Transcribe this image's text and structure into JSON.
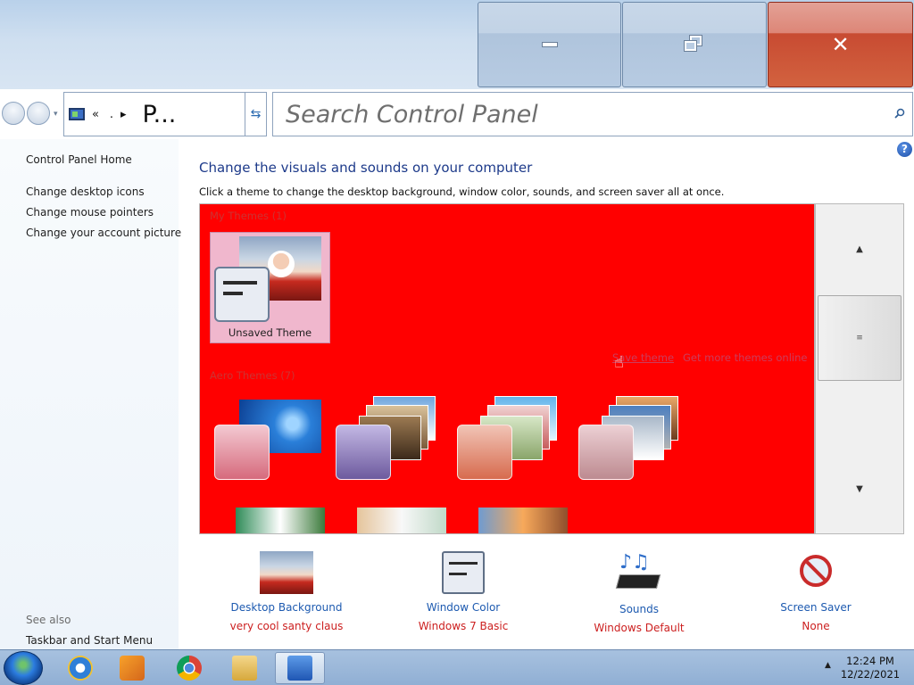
{
  "window": {
    "caption_buttons": {
      "minimize_icon": "minimize-icon",
      "maximize_icon": "restore-icon",
      "close_icon": "close-icon",
      "close_glyph": "✕"
    }
  },
  "address_bar": {
    "crumb_prefix": "«",
    "crumb_middle": "  .",
    "crumb_arrow": "▸",
    "crumb_current": "P...",
    "dropdown_glyph": "▾",
    "refresh_glyph": "⇆"
  },
  "search": {
    "placeholder": "Search Control Panel"
  },
  "sidebar": {
    "home": "Control Panel Home",
    "links": [
      "Change desktop icons",
      "Change mouse pointers",
      "Change your account picture"
    ],
    "see_also_label": "See also",
    "see_also_links": [
      "Taskbar and Start Menu"
    ]
  },
  "main": {
    "help_glyph": "?",
    "heading": "Change the visuals and sounds on your computer",
    "subtext": "Click a theme to change the desktop background, window color, sounds, and screen saver all at once.",
    "panel_color": "#ff0000",
    "my_themes_label": "My Themes (1)",
    "unsaved_theme": "Unsaved Theme",
    "save_theme": "Save theme",
    "get_more_themes": "Get more themes online",
    "aero_themes_label": "Aero Themes (7)",
    "scroll_up": "▲",
    "scroll_thumb": "≡",
    "scroll_down": "▼"
  },
  "settings": [
    {
      "title": "Desktop Background",
      "value": "very cool santy claus",
      "icon": "desktop-background-icon"
    },
    {
      "title": "Window Color",
      "value": "Windows 7 Basic",
      "icon": "window-color-icon"
    },
    {
      "title": "Sounds",
      "value": "Windows Default",
      "icon": "sounds-icon"
    },
    {
      "title": "Screen Saver",
      "value": "None",
      "icon": "screen-saver-icon"
    }
  ],
  "taskbar": {
    "clock_time": "12:24 PM",
    "clock_date": "12/22/2021",
    "tray_glyph": "▲",
    "pinned_icons": [
      "internet-explorer-icon",
      "media-player-icon",
      "chrome-icon",
      "file-explorer-icon",
      "control-panel-icon"
    ]
  },
  "colors": {
    "accent": "#1d3a8a",
    "link": "#1d5ab0",
    "value_red": "#cc1f1f",
    "panel_red": "#ff0000"
  }
}
